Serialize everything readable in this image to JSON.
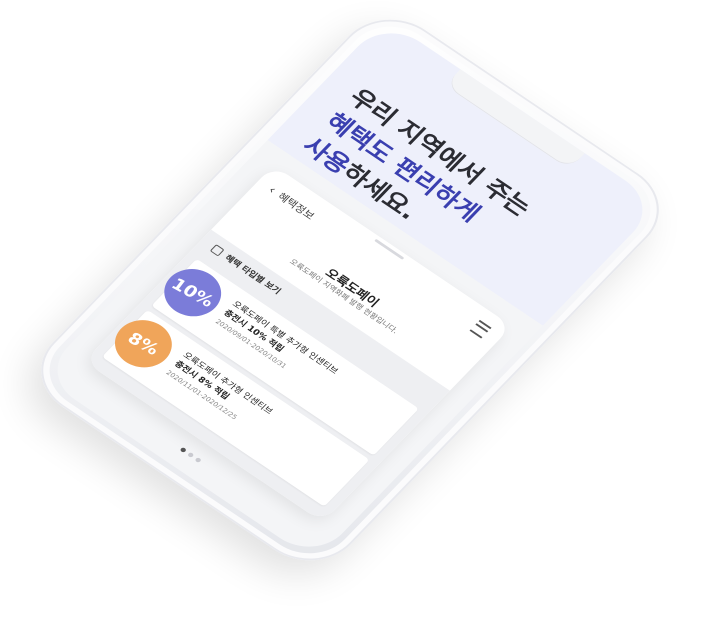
{
  "headline": {
    "line1": "우리 지역에서 주는",
    "line2": "혜택도 편리하게",
    "line3_accent": "사용",
    "line3_rest": "하세요."
  },
  "nav": {
    "back_label": "혜택정보"
  },
  "brand": {
    "name": "오륙도페이",
    "subtitle": "오륙도페이 지역화폐 발행 현황입니다."
  },
  "section": {
    "title": "혜택 타입별 보기"
  },
  "benefits": [
    {
      "badge": "10%",
      "badge_color": "#7b7cd9",
      "title": "오륙도페이 특별 추가형 인센티브",
      "subtitle": "충전시 10% 적립",
      "date": "2020/09/01-2020/10/31"
    },
    {
      "badge": "8%",
      "badge_color": "#f0a55a",
      "title": "오륙도페이 추가형 인센티브",
      "subtitle": "충전시 8% 적립",
      "date": "2020/11/01-2020/12/25"
    }
  ],
  "colors": {
    "accent": "#3a3fb0",
    "headline_bg": "#eef0fb"
  }
}
